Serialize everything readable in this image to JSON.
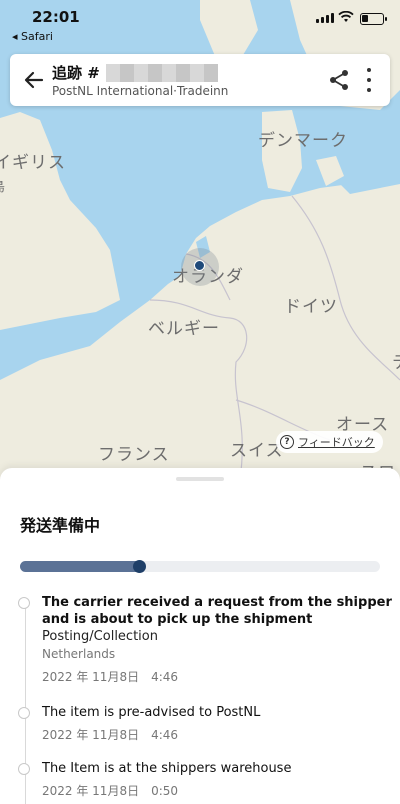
{
  "status_bar": {
    "time": "22:01",
    "back_app": "◂ Safari"
  },
  "header": {
    "title": "追跡 #",
    "carrier": "PostNL International·Tradeinn"
  },
  "map": {
    "labels": {
      "denmark": "デンマーク",
      "uk": "イギリス",
      "uk_fragment": "島",
      "netherlands": "オランダ",
      "germany": "ドイツ",
      "belgium": "ベルギー",
      "austria": "オース",
      "france": "フランス",
      "switzerland": "スイス",
      "slovakia_fragment": "スロ",
      "right_edge_fragment": "テ"
    },
    "feedback_label": "フィードバック"
  },
  "sheet": {
    "status_title": "発送準備中",
    "progress_fraction": 0.33,
    "colors": {
      "progress_fill": "#5b7296",
      "knob": "#1f3f68",
      "track": "#eceef1"
    },
    "events": [
      {
        "title": "The carrier received a request from the shipper and is about to pick up the shipment",
        "subtitle": "Posting/Collection",
        "location": "Netherlands",
        "time": "2022 年 11月8日　4:46"
      },
      {
        "title": "The item is pre-advised to PostNL",
        "time": "2022 年 11月8日　4:46"
      },
      {
        "title": "The Item is at the shippers warehouse",
        "time": "2022 年 11月8日　0:50"
      }
    ]
  }
}
